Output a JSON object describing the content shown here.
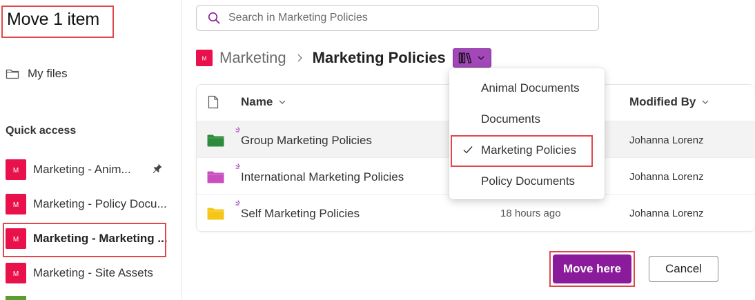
{
  "dialog": {
    "title": "Move 1 item"
  },
  "sidebar": {
    "my_files": "My files",
    "quick_access_title": "Quick access",
    "quick_access": [
      {
        "label": "Marketing - Anim...",
        "badge": "M",
        "pinned": true
      },
      {
        "label": "Marketing - Policy Docu...",
        "badge": "M"
      },
      {
        "label": "Marketing - Marketing ...",
        "badge": "M",
        "active": true
      },
      {
        "label": "Marketing - Site Assets",
        "badge": "M"
      }
    ]
  },
  "search": {
    "placeholder": "Search in Marketing Policies"
  },
  "breadcrumb": {
    "site_badge": "M",
    "site": "Marketing",
    "current": "Marketing Policies"
  },
  "table": {
    "columns": {
      "name": "Name",
      "modified_by": "Modified By"
    },
    "rows": [
      {
        "name": "Group Marketing Policies",
        "modified": "",
        "modified_by": "Johanna Lorenz",
        "folder_color": "#2e8b3d",
        "selected": true
      },
      {
        "name": "International Marketing Policies",
        "modified": "",
        "modified_by": "Johanna Lorenz",
        "folder_color": "#c94fbf"
      },
      {
        "name": "Self Marketing Policies",
        "modified": "18 hours ago",
        "modified_by": "Johanna Lorenz",
        "folder_color": "#f5c518"
      }
    ]
  },
  "library_menu": {
    "items": [
      {
        "label": "Animal Documents"
      },
      {
        "label": "Documents"
      },
      {
        "label": "Marketing Policies",
        "checked": true
      },
      {
        "label": "Policy Documents"
      }
    ]
  },
  "buttons": {
    "move_here": "Move here",
    "cancel": "Cancel"
  },
  "colors": {
    "accent": "#8a1b9a",
    "site_badge": "#e8114b",
    "switcher": "#a347ba",
    "highlight_box": "#e0474c"
  },
  "icons": [
    "folder-outline-icon",
    "pin-icon",
    "search-icon",
    "chevron-right-icon",
    "library-icon",
    "chevron-down-icon",
    "file-icon",
    "folder-icon",
    "new-item-icon",
    "check-icon"
  ]
}
